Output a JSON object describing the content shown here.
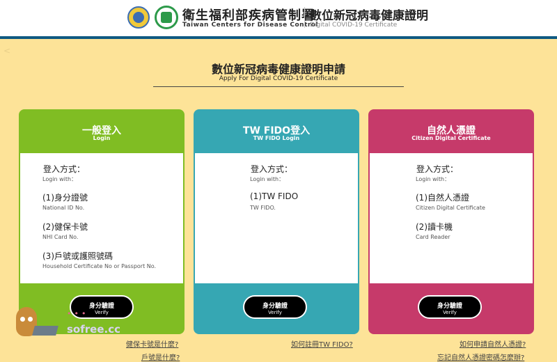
{
  "header": {
    "org_name_cn": "衛生福利部疾病管制署",
    "org_name_en": "Taiwan Centers for Disease Control",
    "site_title_cn": "數位新冠病毒健康證明",
    "site_title_en": "Digital COVID-19 Certificate"
  },
  "page": {
    "title_cn": "數位新冠病毒健康證明申請",
    "title_en": "Apply For Digital COVID-19 Certificate"
  },
  "cards": [
    {
      "title_cn": "一般登入",
      "title_en": "Login",
      "login_with_cn": "登入方式：",
      "login_with_en": "Login with：",
      "options": [
        {
          "cn": "(1)身分證號",
          "en": "National ID No."
        },
        {
          "cn": "(2)健保卡號",
          "en": "NHI Card No."
        },
        {
          "cn": "(3)戶號或護照號碼",
          "en": "Household Certificate No or Passport No."
        }
      ],
      "verify_cn": "身分驗證",
      "verify_en": "Verify",
      "help_links": [
        "健保卡號是什麼?",
        "戶號是什麼?"
      ]
    },
    {
      "title_cn": "TW FIDO登入",
      "title_en": "TW FIDO Login",
      "login_with_cn": "登入方式：",
      "login_with_en": "Login with：",
      "options": [
        {
          "cn": "(1)TW FIDO",
          "en": "TW FIDO."
        }
      ],
      "verify_cn": "身分驗證",
      "verify_en": "Verify",
      "help_links": [
        "如何註冊TW FIDO?"
      ]
    },
    {
      "title_cn": "自然人憑證",
      "title_en": "Citizen Digital Certificate",
      "login_with_cn": "登入方式：",
      "login_with_en": "Login with：",
      "options": [
        {
          "cn": "(1)自然人憑證",
          "en": "Citizen Digital Certificate"
        },
        {
          "cn": "(2)讀卡機",
          "en": "Card Reader"
        }
      ],
      "verify_cn": "身分驗證",
      "verify_en": "Verify",
      "help_links": [
        "如何申請自然人憑證?",
        "忘記自然人憑證密碼怎麼辦?"
      ]
    }
  ],
  "watermark": {
    "text": "sofree.cc"
  },
  "colors": {
    "background": "#fde398",
    "card_login": "#80bd23",
    "card_fido": "#36a7b3",
    "card_citizen": "#c63a6a",
    "header_border": "#0f5a82"
  },
  "icons": [
    "cdc-seal-logo-icon",
    "mohw-logo-icon",
    "back-arrow-icon"
  ]
}
